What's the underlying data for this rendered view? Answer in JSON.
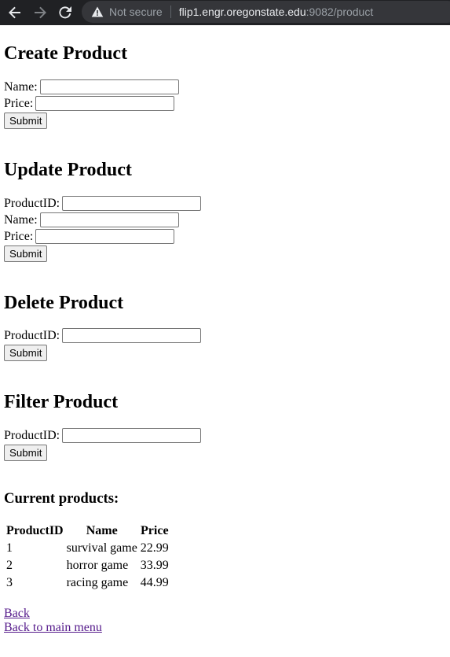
{
  "browser": {
    "not_secure": "Not secure",
    "url_host": "flip1.engr.oregonstate.edu",
    "url_rest": ":9082/product"
  },
  "create": {
    "title": "Create Product",
    "name_label": "Name:",
    "price_label": "Price:",
    "submit": "Submit"
  },
  "update": {
    "title": "Update Product",
    "id_label": "ProductID:",
    "name_label": "Name:",
    "price_label": "Price:",
    "submit": "Submit"
  },
  "delete": {
    "title": "Delete Product",
    "id_label": "ProductID:",
    "submit": "Submit"
  },
  "filter": {
    "title": "Filter Product",
    "id_label": "ProductID:",
    "submit": "Submit"
  },
  "current": {
    "title": "Current products:",
    "headers": [
      "ProductID",
      "Name",
      "Price"
    ],
    "rows": [
      [
        "1",
        "survival game",
        "22.99"
      ],
      [
        "2",
        "horror game",
        "33.99"
      ],
      [
        "3",
        "racing game",
        "44.99"
      ]
    ]
  },
  "links": {
    "back": "Back",
    "main_menu": "Back to main menu"
  }
}
